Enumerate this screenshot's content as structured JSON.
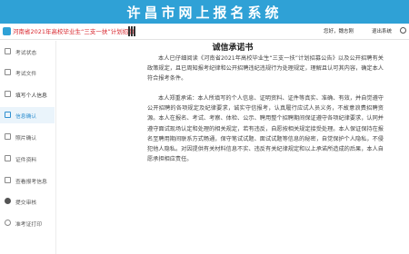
{
  "header": {
    "site_title": "许昌市网上报名系统"
  },
  "topbar": {
    "exam_name": "河南省2021年高校毕业生“三支一扶”计划招募",
    "welcome": "您好，魏志刚",
    "logout": "退出系统"
  },
  "sidebar": {
    "items": [
      {
        "label": "考试状态",
        "icon": "status-icon"
      },
      {
        "label": "考试文件",
        "icon": "file-icon"
      },
      {
        "label": "填写个人信息",
        "icon": "edit-icon"
      },
      {
        "label": "信息确认",
        "icon": "check-icon"
      },
      {
        "label": "照片确认",
        "icon": "photo-icon"
      },
      {
        "label": "证件资料",
        "icon": "id-icon"
      },
      {
        "label": "查看报考信息",
        "icon": "info-icon"
      },
      {
        "label": "提交审核",
        "icon": "submit-icon"
      },
      {
        "label": "准考证打印",
        "icon": "print-icon"
      }
    ]
  },
  "letter": {
    "title": "诚信承诺书",
    "paragraph1": "本人已仔细阅读《河南省2021年高校毕业生“三支一扶”计划招募公告》以及公开招聘有关政策规定，且已周知报考纪律和公开招聘违纪违规行为处理规定，理解且认可其内容，确定本人符合报考条件。",
    "paragraph2": "本人郑重承诺：本人所填写的个人信息、证明资料、证件等真实、准确、有效，并自觉遵守公开招聘的各项规定及纪律要求，诚实守信报考，认真履行应试人员义务，不故意浪费招聘资源。本人在报名、考试、考察、体检、公示、聘用整个招聘期间保证遵守各项纪律要求，认同并遵守面试现场认定和处理的相关规定，若有违反，自愿按相关规定接受处理。本人保证保持在报名至聘用期间联系方式畅通，保守笔试试题、面试试题等信息的秘密，自觉保护个人隐私，不侵犯他人隐私。对因提供有关材料信息不实、违反有关纪律规定和以上承诺所造成的后果，本人自愿承担相应责任。"
  },
  "colors": {
    "banner": "#2fa1d6",
    "exam_name": "#d8262d",
    "active_nav": "#2f8fd0"
  }
}
